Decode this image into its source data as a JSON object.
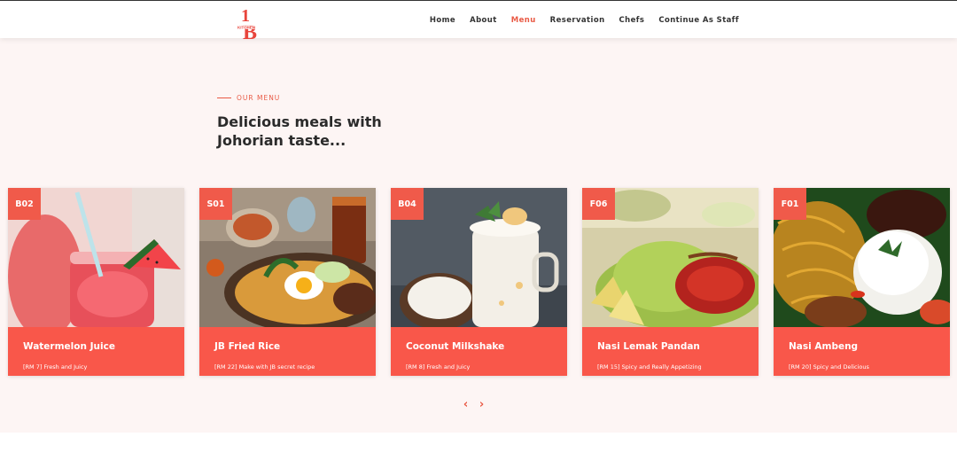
{
  "logo": {
    "digit": "1",
    "letter": "B",
    "word": "KITCHEN",
    "color": "#e8453c"
  },
  "nav": {
    "items": [
      {
        "label": "Home"
      },
      {
        "label": "About"
      },
      {
        "label": "Menu",
        "active": true
      },
      {
        "label": "Reservation"
      },
      {
        "label": "Chefs"
      },
      {
        "label": "Continue As Staff"
      }
    ],
    "active_color": "#e95a45"
  },
  "section": {
    "eyebrow": "OUR MENU",
    "heading_line1": "Delicious meals with",
    "heading_line2": "Johorian taste..."
  },
  "menu_items": [
    {
      "code": "B02",
      "title": "Watermelon Juice",
      "desc": "[RM 7] Fresh and Juicy"
    },
    {
      "code": "S01",
      "title": "JB Fried Rice",
      "desc": "[RM 22] Make with JB secret recipe"
    },
    {
      "code": "B04",
      "title": "Coconut Milkshake",
      "desc": "[RM 8] Fresh and Juicy"
    },
    {
      "code": "F06",
      "title": "Nasi Lemak Pandan",
      "desc": "[RM 15] Spicy and Really Appetizing"
    },
    {
      "code": "F01",
      "title": "Nasi Ambeng",
      "desc": "[RM 20] Spicy and Delicious"
    }
  ],
  "carousel": {
    "prev_icon": "chevron-left-icon",
    "next_icon": "chevron-right-icon",
    "prev_glyph": "‹",
    "next_glyph": "›"
  },
  "colors": {
    "accent": "#f9574a",
    "section_bg": "#fdf5f4",
    "heading": "#2b2b2b"
  }
}
